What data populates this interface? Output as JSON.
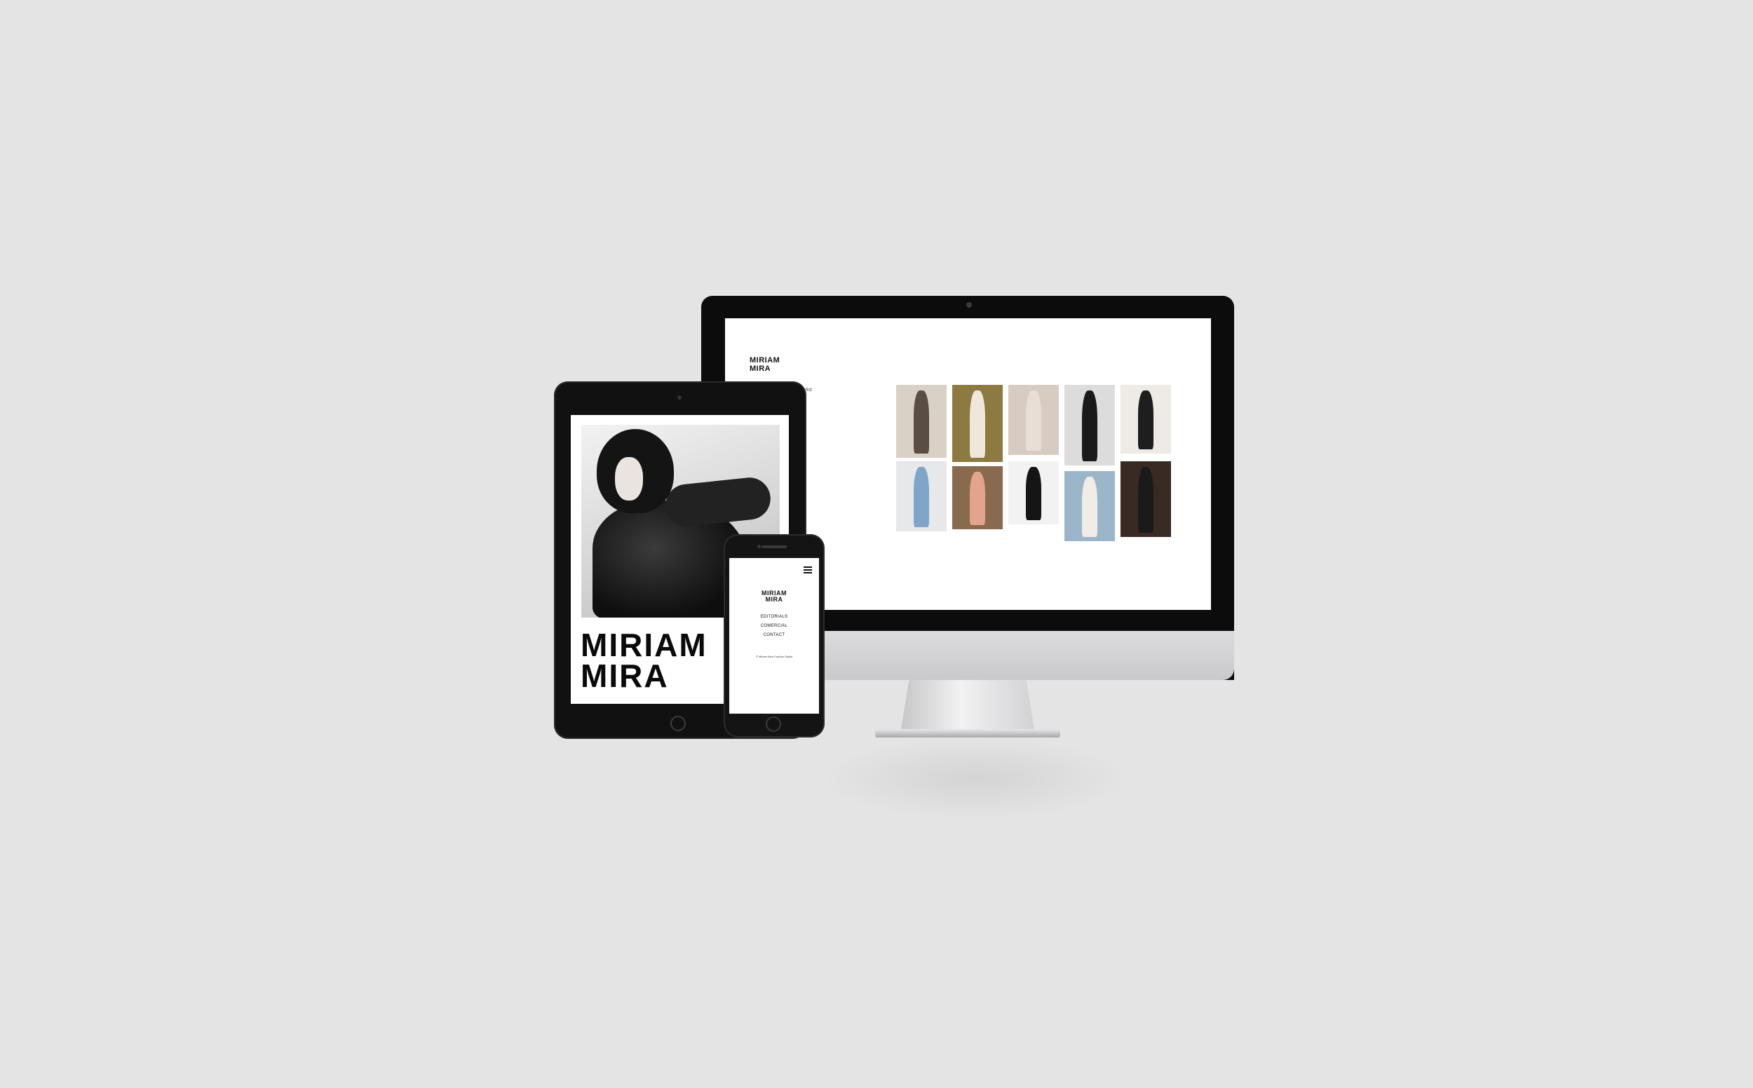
{
  "brand": {
    "line1": "MIRIAM",
    "line2": "MIRA"
  },
  "desktop": {
    "stylist_fragment": "tylist",
    "gallery": [
      {
        "bg": "#d9d0c6",
        "fig": "#5a4e44"
      },
      {
        "bg": "#8c7a40",
        "fig": "#efe7dc"
      },
      {
        "bg": "#d8ccc2",
        "fig": "#e8ded6"
      },
      {
        "bg": "#dcdcdc",
        "fig": "#1a1a1a"
      },
      {
        "bg": "#eeeae6",
        "fig": "#1e1e1e"
      },
      {
        "bg": "#e6e8ea",
        "fig": "#7ea6c8"
      },
      {
        "bg": "#8a6a4e",
        "fig": "#e2a48c"
      },
      {
        "bg": "#f2f2f2",
        "fig": "#151515"
      },
      {
        "bg": "#9bb6c9",
        "fig": "#f0ece6"
      },
      {
        "bg": "#3a2a24",
        "fig": "#1a1a1a"
      }
    ]
  },
  "mobile": {
    "nav": [
      "EDITORIALS",
      "COMERCIAL",
      "CONTACT"
    ],
    "footer": "© Miriam Mira Fashion Stylist"
  }
}
